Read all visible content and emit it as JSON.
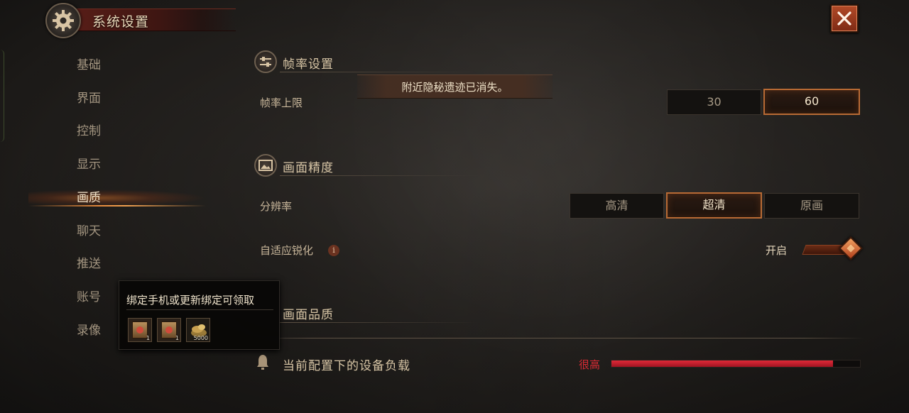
{
  "header": {
    "title": "系统设置",
    "icon": "gear-icon"
  },
  "close": {
    "icon": "close-icon"
  },
  "nav": {
    "items": [
      {
        "label": "基础",
        "active": false
      },
      {
        "label": "界面",
        "active": false
      },
      {
        "label": "控制",
        "active": false
      },
      {
        "label": "显示",
        "active": false
      },
      {
        "label": "画质",
        "active": true
      },
      {
        "label": "聊天",
        "active": false
      },
      {
        "label": "推送",
        "active": false
      },
      {
        "label": "账号",
        "active": false
      },
      {
        "label": "录像",
        "active": false
      }
    ]
  },
  "toast": {
    "text": "附近隐秘遗迹已消失。"
  },
  "framerate": {
    "section_title": "帧率设置",
    "label": "帧率上限",
    "options": [
      "30",
      "60"
    ],
    "selected": "60"
  },
  "precision": {
    "section_title": "画面精度",
    "resolution_label": "分辨率",
    "options": [
      "高清",
      "超清",
      "原画"
    ],
    "selected": "超清",
    "sharpen_label": "自适应锐化",
    "info_glyph": "i",
    "sharpen_state": "开启"
  },
  "quality": {
    "section_title": "画面品质"
  },
  "load": {
    "label": "当前配置下的设备负载",
    "value": "很高",
    "level_fraction": 0.89,
    "bar_color": "#d82a34"
  },
  "popup": {
    "title": "绑定手机或更新绑定可领取",
    "rewards": [
      {
        "icon": "coupon-icon",
        "count": "1"
      },
      {
        "icon": "coupon-icon",
        "count": "1"
      },
      {
        "icon": "gold-icon",
        "count": "5000"
      }
    ]
  },
  "colors": {
    "accent": "#b86a34",
    "danger": "#d82a34"
  }
}
